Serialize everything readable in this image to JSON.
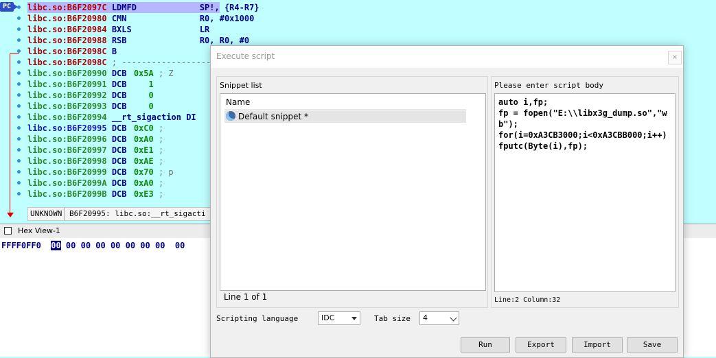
{
  "disasm": {
    "pc_label": "PC",
    "lines": [
      {
        "addr": "libc.so:B6F2097C",
        "mnem": "LDMFD",
        "op": "SP!, {R4-R7}",
        "opcolor": "opnd",
        "addrcolor": "red"
      },
      {
        "addr": "libc.so:B6F20980",
        "mnem": "CMN",
        "op": "R0, #0x1000",
        "opcolor": "opnd",
        "addrcolor": "red"
      },
      {
        "addr": "libc.so:B6F20984",
        "mnem": "BXLS",
        "op": "LR",
        "opcolor": "opnd",
        "addrcolor": "red"
      },
      {
        "addr": "libc.so:B6F20988",
        "mnem": "RSB",
        "op": "R0, R0, #0",
        "opcolor": "opnd",
        "addrcolor": "red"
      },
      {
        "addr": "libc.so:B6F2098C",
        "mnem": "B",
        "op": "",
        "opcolor": "opnd",
        "addrcolor": "red"
      },
      {
        "addr": "libc.so:B6F2098C",
        "mnem": "; -----------------------------",
        "op": "",
        "opcolor": "cmt",
        "addrcolor": "red"
      },
      {
        "addr": "libc.so:B6F20990",
        "mnem": "DCB",
        "op": "0x5A",
        "cmt": " ; Z",
        "opcolor": "num",
        "addrcolor": "green"
      },
      {
        "addr": "libc.so:B6F20991",
        "mnem": "DCB",
        "op": "   1",
        "opcolor": "num",
        "addrcolor": "green"
      },
      {
        "addr": "libc.so:B6F20992",
        "mnem": "DCB",
        "op": "   0",
        "opcolor": "num",
        "addrcolor": "green"
      },
      {
        "addr": "libc.so:B6F20993",
        "mnem": "DCB",
        "op": "   0",
        "opcolor": "num",
        "addrcolor": "green"
      },
      {
        "addr": "libc.so:B6F20994",
        "mnem": "__rt_sigaction DI",
        "op": "",
        "opcolor": "opnd",
        "addrcolor": "green"
      },
      {
        "addr": "libc.so:B6F20995",
        "mnem": "DCB",
        "op": "0xC0",
        "cmt": " ;",
        "opcolor": "num",
        "addrcolor": "blue"
      },
      {
        "addr": "libc.so:B6F20996",
        "mnem": "DCB",
        "op": "0xA0",
        "cmt": " ;",
        "opcolor": "num",
        "addrcolor": "green"
      },
      {
        "addr": "libc.so:B6F20997",
        "mnem": "DCB",
        "op": "0xE1",
        "cmt": " ;",
        "opcolor": "num",
        "addrcolor": "green"
      },
      {
        "addr": "libc.so:B6F20998",
        "mnem": "DCB",
        "op": "0xAE",
        "cmt": " ;",
        "opcolor": "num",
        "addrcolor": "green"
      },
      {
        "addr": "libc.so:B6F20999",
        "mnem": "DCB",
        "op": "0x70",
        "cmt": " ; p",
        "opcolor": "num",
        "addrcolor": "green"
      },
      {
        "addr": "libc.so:B6F2099A",
        "mnem": "DCB",
        "op": "0xA0",
        "cmt": " ;",
        "opcolor": "num",
        "addrcolor": "green"
      },
      {
        "addr": "libc.so:B6F2099B",
        "mnem": "DCB",
        "op": "0xE3",
        "cmt": " ;",
        "opcolor": "num",
        "addrcolor": "green"
      }
    ],
    "status_mode": "UNKNOWN",
    "status_text": "B6F20995: libc.so:__rt_sigacti"
  },
  "hexview": {
    "title": "Hex View-1",
    "addr": "FFFF0FF0",
    "selected_byte": "00",
    "rest_bytes": " 00 00 00 00 00 00 00  00"
  },
  "dialog": {
    "title": "Execute script",
    "close_glyph": "×",
    "snippet_list_label": "Snippet list",
    "column_name": "Name",
    "snippet_item": "Default snippet *",
    "line_info": "Line 1 of 1",
    "script_body_label": "Please enter script body",
    "script_body": "auto i,fp;\nfp = fopen(\"E:\\\\libx3g_dump.so\",\"wb\");\nfor(i=0xA3CB3000;i<0xA3CBB000;i++)\nfputc(Byte(i),fp);",
    "cursor_pos": "Line:2  Column:32",
    "scripting_language_label": "Scripting language",
    "scripting_language_value": "IDC",
    "tab_size_label": "Tab size",
    "tab_size_value": "4",
    "buttons": {
      "run": "Run",
      "export": "Export",
      "import": "Import",
      "save": "Save"
    }
  }
}
